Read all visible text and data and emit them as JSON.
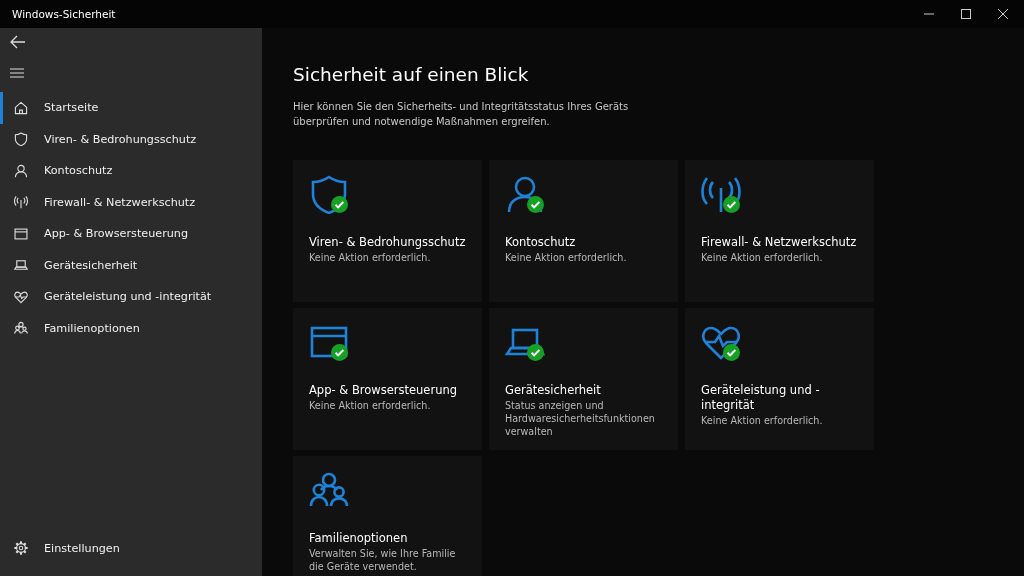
{
  "window": {
    "title": "Windows-Sicherheit"
  },
  "sidebar": {
    "items": [
      {
        "kind": "home",
        "label": "Startseite",
        "selected": true
      },
      {
        "kind": "shield",
        "label": "Viren- & Bedrohungsschutz",
        "selected": false
      },
      {
        "kind": "person",
        "label": "Kontoschutz",
        "selected": false
      },
      {
        "kind": "antenna",
        "label": "Firewall- & Netzwerkschutz",
        "selected": false
      },
      {
        "kind": "window",
        "label": "App- & Browsersteuerung",
        "selected": false
      },
      {
        "kind": "laptop",
        "label": "Gerätesicherheit",
        "selected": false
      },
      {
        "kind": "heart",
        "label": "Geräteleistung und -integrität",
        "selected": false
      },
      {
        "kind": "family",
        "label": "Familienoptionen",
        "selected": false
      }
    ],
    "settings": {
      "label": "Einstellungen"
    }
  },
  "main": {
    "heading": "Sicherheit auf einen Blick",
    "intro": "Hier können Sie den Sicherheits- und Integritätsstatus Ihres Geräts überprüfen und notwendige Maßnahmen ergreifen.",
    "cards": [
      {
        "kind": "shield",
        "title": "Viren- & Bedrohungsschutz",
        "description": "Keine Aktion erforderlich.",
        "ok": true
      },
      {
        "kind": "person",
        "title": "Kontoschutz",
        "description": "Keine Aktion erforderlich.",
        "ok": true
      },
      {
        "kind": "antenna",
        "title": "Firewall- & Netzwerkschutz",
        "description": "Keine Aktion erforderlich.",
        "ok": true
      },
      {
        "kind": "window",
        "title": "App- & Browsersteuerung",
        "description": "Keine Aktion erforderlich.",
        "ok": true
      },
      {
        "kind": "laptop",
        "title": "Gerätesicherheit",
        "description": "Status anzeigen und Hardwaresicherheitsfunktionen verwalten",
        "ok": true
      },
      {
        "kind": "heart",
        "title": "Geräteleistung und -integrität",
        "description": "Keine Aktion erforderlich.",
        "ok": true
      },
      {
        "kind": "family",
        "title": "Familienoptionen",
        "description": "Verwalten Sie, wie Ihre Familie die Geräte verwendet.",
        "ok": false
      }
    ]
  }
}
